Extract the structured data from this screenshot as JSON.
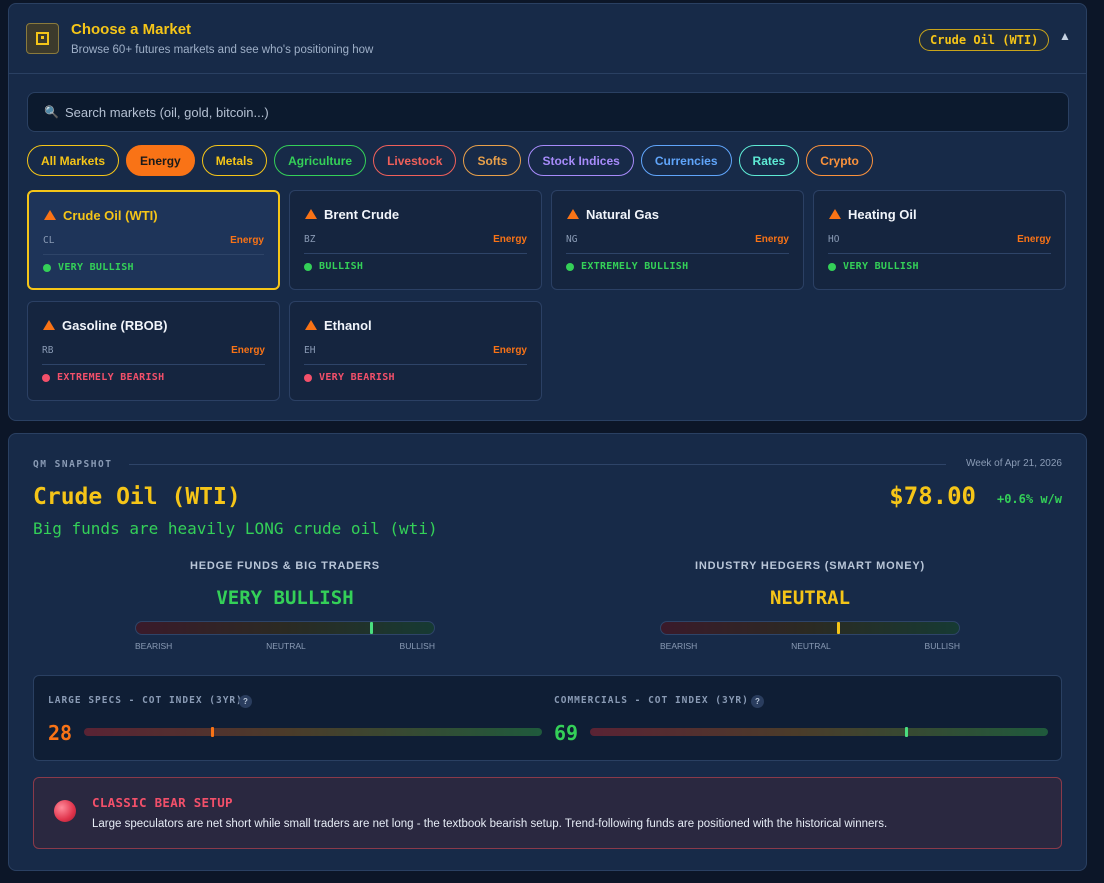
{
  "header": {
    "title": "Choose a Market",
    "subtitle": "Browse 60+ futures markets and see who's positioning how",
    "selected_market": "Crude Oil (WTI)",
    "collapse_icon": "▲"
  },
  "search": {
    "icon": "🔍",
    "placeholder": "Search markets (oil, gold, bitcoin...)",
    "value": ""
  },
  "filters": [
    {
      "label": "All Markets",
      "color": "#f5c518",
      "active": false
    },
    {
      "label": "Energy",
      "color": "#f97316",
      "active": true
    },
    {
      "label": "Metals",
      "color": "#f5c518",
      "active": false
    },
    {
      "label": "Agriculture",
      "color": "#34d058",
      "active": false
    },
    {
      "label": "Livestock",
      "color": "#f0605a",
      "active": false
    },
    {
      "label": "Softs",
      "color": "#e8a04a",
      "active": false
    },
    {
      "label": "Stock Indices",
      "color": "#a78bfa",
      "active": false
    },
    {
      "label": "Currencies",
      "color": "#60a5fa",
      "active": false
    },
    {
      "label": "Rates",
      "color": "#5eead4",
      "active": false
    },
    {
      "label": "Crypto",
      "color": "#fb923c",
      "active": false
    }
  ],
  "markets": [
    {
      "name": "Crude Oil (WTI)",
      "code": "CL",
      "sector": "Energy",
      "status": "VERY BULLISH",
      "status_color": "#34d058",
      "selected": true
    },
    {
      "name": "Brent Crude",
      "code": "BZ",
      "sector": "Energy",
      "status": "BULLISH",
      "status_color": "#34d058",
      "selected": false
    },
    {
      "name": "Natural Gas",
      "code": "NG",
      "sector": "Energy",
      "status": "EXTREMELY BULLISH",
      "status_color": "#34d058",
      "selected": false
    },
    {
      "name": "Heating Oil",
      "code": "HO",
      "sector": "Energy",
      "status": "VERY BULLISH",
      "status_color": "#34d058",
      "selected": false
    },
    {
      "name": "Gasoline (RBOB)",
      "code": "RB",
      "sector": "Energy",
      "status": "EXTREMELY BEARISH",
      "status_color": "#f3506a",
      "selected": false
    },
    {
      "name": "Ethanol",
      "code": "EH",
      "sector": "Energy",
      "status": "VERY BEARISH",
      "status_color": "#f3506a",
      "selected": false
    }
  ],
  "snapshot": {
    "label": "QM SNAPSHOT",
    "week": "Week of Apr 21, 2026",
    "title": "Crude Oil (WTI)",
    "subtitle": "Big funds are heavily LONG crude oil (wti)",
    "price": "$78.00",
    "change": "+0.6% w/w"
  },
  "gauges": [
    {
      "title": "HEDGE FUNDS & BIG TRADERS",
      "value": "VERY BULLISH",
      "value_color": "#34d058",
      "level": 0.79,
      "marker_color": "#4ade80",
      "labels": [
        "BEARISH",
        "NEUTRAL",
        "BULLISH"
      ]
    },
    {
      "title": "INDUSTRY HEDGERS (SMART MONEY)",
      "value": "NEUTRAL",
      "value_color": "#f5c518",
      "level": 0.595,
      "marker_color": "#f5c518",
      "labels": [
        "BEARISH",
        "NEUTRAL",
        "BULLISH"
      ]
    }
  ],
  "cot": [
    {
      "title": "LARGE SPECS - COT INDEX (3YR)",
      "help": "?",
      "value": "28",
      "value_color": "#f97316",
      "level": 0.28,
      "marker_color": "#f97316"
    },
    {
      "title": "COMMERCIALS - COT INDEX (3YR)",
      "help": "?",
      "value": "69",
      "value_color": "#34d058",
      "level": 0.69,
      "marker_color": "#4ade80"
    }
  ],
  "alert": {
    "title": "CLASSIC BEAR SETUP",
    "text": "Large speculators are net short while small traders are net long - the textbook bearish setup. Trend-following funds are positioned with the historical winners."
  }
}
